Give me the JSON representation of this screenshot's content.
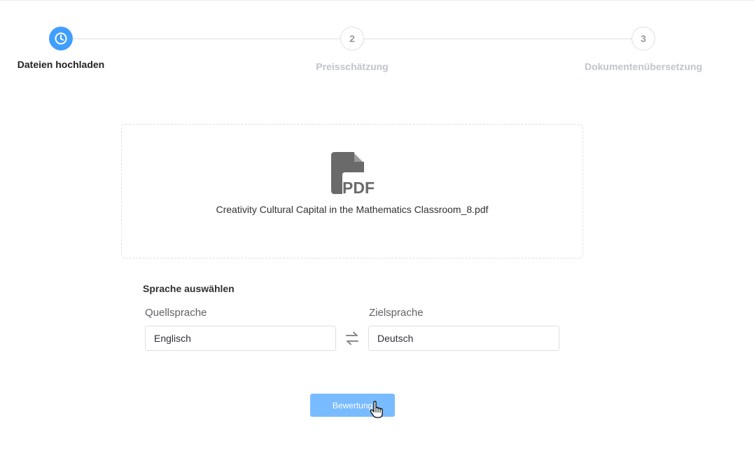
{
  "stepper": {
    "steps": [
      {
        "number": "",
        "label": "Dateien hochladen",
        "state": "active",
        "icon": "clock-icon"
      },
      {
        "number": "2",
        "label": "Preisschätzung",
        "state": "pending"
      },
      {
        "number": "3",
        "label": "Dokumentenübersetzung",
        "state": "pending"
      }
    ]
  },
  "upload": {
    "file_icon": "pdf-file-icon",
    "file_icon_text": "PDF",
    "file_name": "Creativity Cultural Capital in the Mathematics Classroom_8.pdf"
  },
  "language": {
    "title": "Sprache auswählen",
    "source_label": "Quellsprache",
    "source_value": "Englisch",
    "target_label": "Zielsprache",
    "target_value": "Deutsch",
    "swap_icon": "swap-arrows-icon"
  },
  "actions": {
    "submit_label": "Bewertung"
  },
  "colors": {
    "accent": "#409eff",
    "button": "#79bbff",
    "icon_gray": "#6a6a6a"
  }
}
